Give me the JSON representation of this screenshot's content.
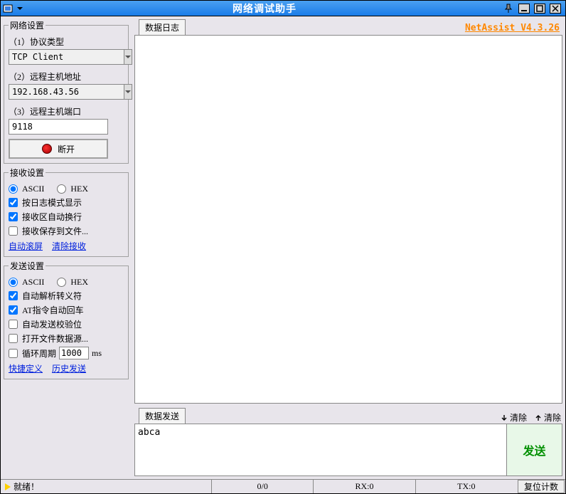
{
  "window": {
    "title": "网络调试助手"
  },
  "brand": "NetAssist V4.3.26",
  "network_settings": {
    "legend": "网络设置",
    "proto_label": "（1）协议类型",
    "proto_value": "TCP Client",
    "host_label": "（2）远程主机地址",
    "host_value": "192.168.43.56",
    "port_label": "（3）远程主机端口",
    "port_value": "9118",
    "disconnect_label": "断开"
  },
  "recv_settings": {
    "legend": "接收设置",
    "ascii": "ASCII",
    "hex": "HEX",
    "log_mode": "按日志模式显示",
    "auto_wrap": "接收区自动换行",
    "save_file": "接收保存到文件...",
    "auto_scroll": "自动滚屏",
    "clear_recv": "清除接收"
  },
  "send_settings": {
    "legend": "发送设置",
    "ascii": "ASCII",
    "hex": "HEX",
    "auto_escape": "自动解析转义符",
    "at_return": "AT指令自动回车",
    "auto_crc": "自动发送校验位",
    "open_file": "打开文件数据源...",
    "loop_label": "循环周期",
    "loop_value": "1000",
    "loop_unit": "ms",
    "quick_def": "快捷定义",
    "history": "历史发送"
  },
  "log_tab": "数据日志",
  "send_tab": "数据发送",
  "clear1": "清除",
  "clear2": "清除",
  "send_text": "abca",
  "send_btn": "发送",
  "status": {
    "ready": "就绪！",
    "counts": "0/0",
    "rx": "RX:0",
    "tx": "TX:0",
    "reset": "复位计数"
  }
}
